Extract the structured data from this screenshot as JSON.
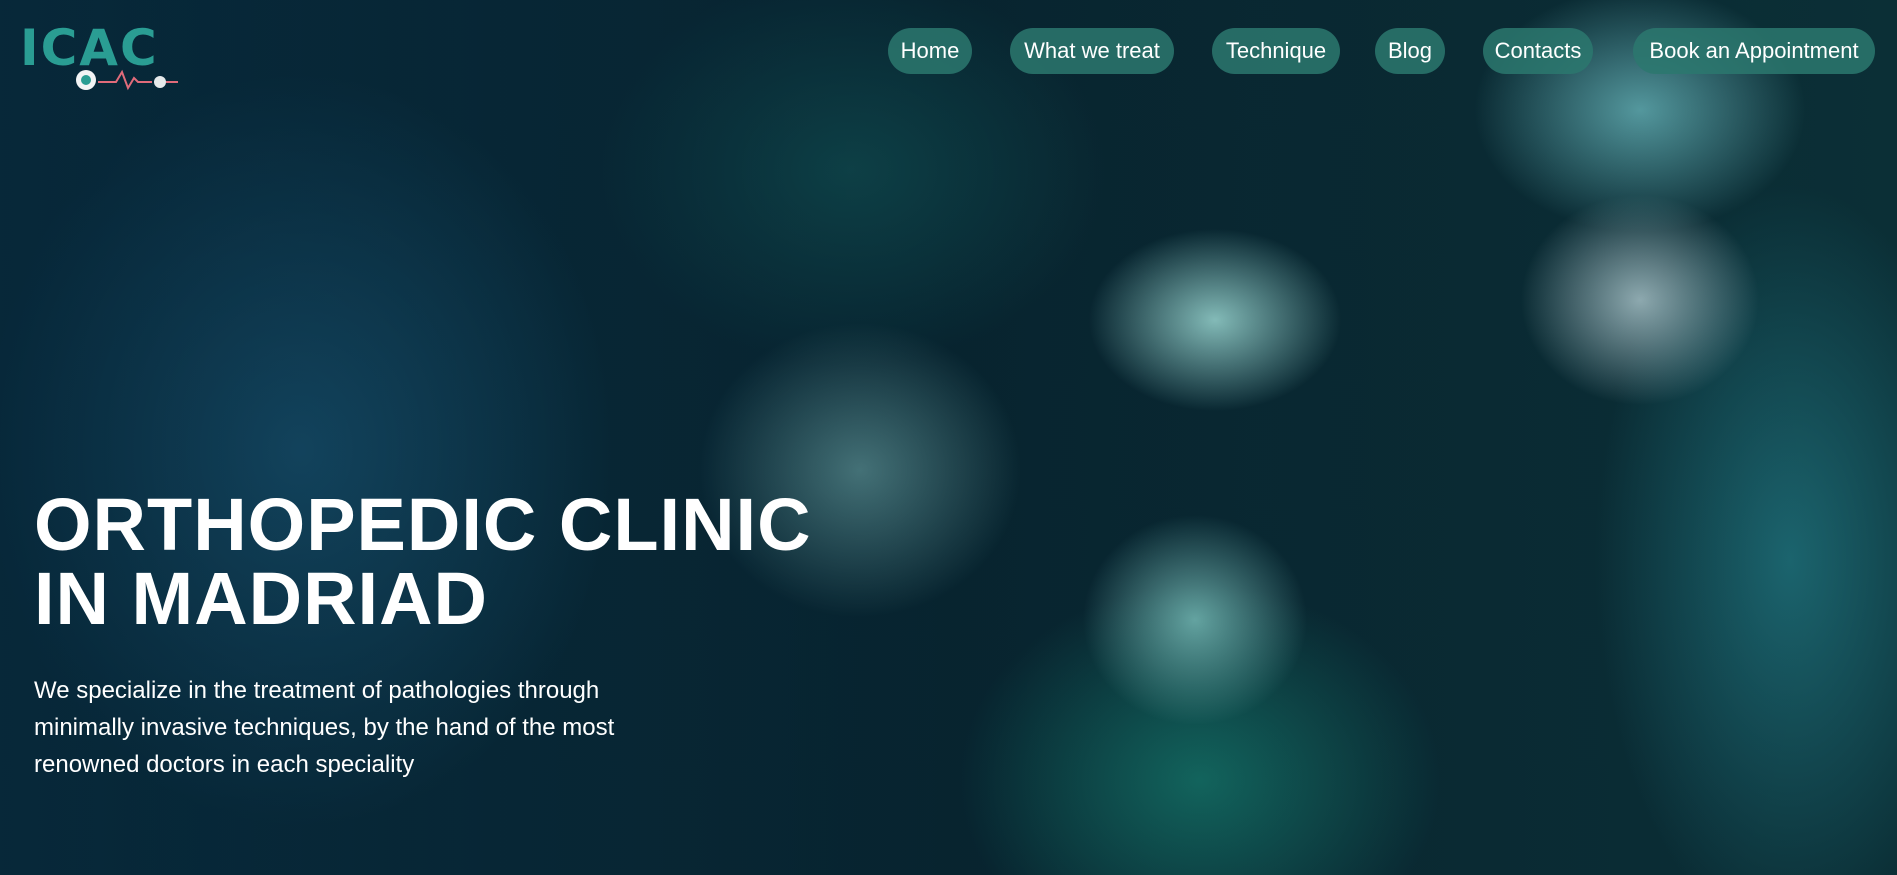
{
  "brand": {
    "logo_text": "ICAC",
    "primary_color": "#2a9d93",
    "nav_color": "#2c786e"
  },
  "nav": {
    "items": [
      {
        "label": "Home"
      },
      {
        "label": "What we treat"
      },
      {
        "label": "Technique"
      },
      {
        "label": "Blog"
      },
      {
        "label": "Contacts"
      },
      {
        "label": "Book an Appointment"
      }
    ]
  },
  "hero": {
    "background_image": "surgeons-in-operating-room",
    "headline_line1": "ORTHOPEDIC CLINIC",
    "headline_line2": "IN MADRIAD",
    "description": "We specialize in the treatment of pathologies through minimally invasive techniques, by the hand of the most renowned doctors in each speciality"
  }
}
